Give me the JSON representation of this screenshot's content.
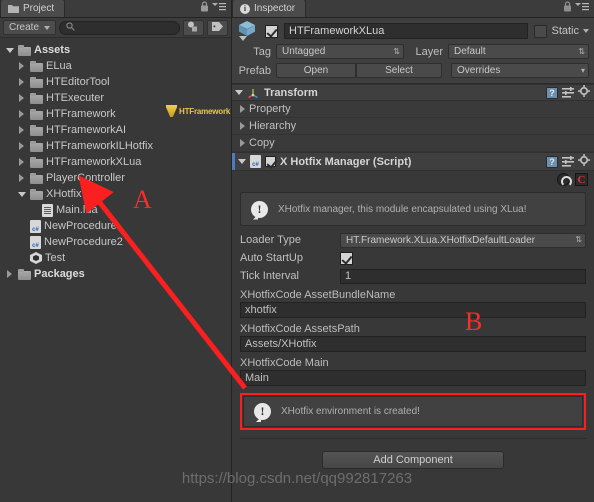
{
  "project": {
    "tab_label": "Project",
    "tab_icon": "folder-icon",
    "lock_icon": "lock-icon",
    "menu_icon": "hamburger-menu-icon",
    "create_label": "Create",
    "search_placeholder": "",
    "search_value": "",
    "search_icon": "search-icon",
    "filter_by_type_icon": "filter-by-type-icon",
    "filter_by_label_icon": "filter-by-label-icon",
    "tree": [
      {
        "label": "Assets",
        "indent": 0,
        "expanded": true,
        "icon": "folder-icon",
        "bold": true
      },
      {
        "label": "ELua",
        "indent": 1,
        "expanded": false,
        "icon": "folder-icon",
        "bold": false
      },
      {
        "label": "HTEditorTool",
        "indent": 1,
        "expanded": false,
        "icon": "folder-icon",
        "bold": false
      },
      {
        "label": "HTExecuter",
        "indent": 1,
        "expanded": false,
        "icon": "folder-icon",
        "bold": false
      },
      {
        "label": "HTFramework",
        "indent": 1,
        "expanded": false,
        "icon": "folder-icon",
        "bold": false
      },
      {
        "label": "HTFrameworkAI",
        "indent": 1,
        "expanded": false,
        "icon": "folder-icon",
        "bold": false
      },
      {
        "label": "HTFrameworkILHotfix",
        "indent": 1,
        "expanded": false,
        "icon": "folder-icon",
        "bold": false
      },
      {
        "label": "HTFrameworkXLua",
        "indent": 1,
        "expanded": false,
        "icon": "folder-icon",
        "bold": false
      },
      {
        "label": "PlayerController",
        "indent": 1,
        "expanded": false,
        "icon": "folder-icon",
        "bold": false
      },
      {
        "label": "XHotfix",
        "indent": 1,
        "expanded": true,
        "icon": "folder-icon",
        "bold": false
      },
      {
        "label": "Main.lua",
        "indent": 2,
        "expanded": null,
        "icon": "text-file-icon",
        "bold": false
      },
      {
        "label": "NewProcedure",
        "indent": 1,
        "expanded": null,
        "icon": "csharp-script-icon",
        "bold": false
      },
      {
        "label": "NewProcedure2",
        "indent": 1,
        "expanded": null,
        "icon": "csharp-script-icon",
        "bold": false
      },
      {
        "label": "Test",
        "indent": 1,
        "expanded": null,
        "icon": "unity-scene-icon",
        "bold": false
      },
      {
        "label": "Packages",
        "indent": 0,
        "expanded": false,
        "icon": "folder-icon",
        "bold": true
      }
    ],
    "htframework_badge": "HTFramework"
  },
  "inspector": {
    "tab_label": "Inspector",
    "tab_icon": "info-icon",
    "lock_icon": "lock-icon",
    "menu_icon": "hamburger-menu-icon",
    "gameobject": {
      "icon": "gameobject-cube-icon",
      "enabled": true,
      "name": "HTFrameworkXLua",
      "static_label": "Static",
      "static_checked": false,
      "tag_label": "Tag",
      "tag_value": "Untagged",
      "layer_label": "Layer",
      "layer_value": "Default",
      "prefab_label": "Prefab",
      "prefab_open": "Open",
      "prefab_select": "Select",
      "prefab_overrides": "Overrides"
    },
    "transform": {
      "title": "Transform",
      "icon": "transform-axis-icon",
      "expanded": true,
      "sub_rows": [
        "Property",
        "Hierarchy",
        "Copy"
      ],
      "help_icon": "help-icon",
      "preset_icon": "preset-icon",
      "gear_icon": "gear-icon"
    },
    "script_component": {
      "title": "X Hotfix Manager (Script)",
      "icon": "csharp-script-icon",
      "enabled": true,
      "expanded": true,
      "help_icon": "help-icon",
      "preset_icon": "preset-icon",
      "gear_icon": "gear-icon",
      "github_icon": "github-icon",
      "csdn_icon": "csdn-c-icon",
      "helpbox_icon": "info-circle-icon",
      "helpbox_text": "XHotfix manager, this module encapsulated using XLua!",
      "fields": [
        {
          "label": "Loader Type",
          "value": "HT.Framework.XLua.XHotfixDefaultLoader",
          "kind": "dropdown"
        },
        {
          "label": "Auto StartUp",
          "value": true,
          "kind": "checkbox"
        },
        {
          "label": "Tick Interval",
          "value": "1",
          "kind": "text"
        }
      ],
      "wide_fields": [
        {
          "label": "XHotfixCode AssetBundleName",
          "value": "xhotfix"
        },
        {
          "label": "XHotfixCode AssetsPath",
          "value": "Assets/XHotfix"
        },
        {
          "label": "XHotfixCode Main",
          "value": "Main"
        }
      ],
      "status_icon": "info-circle-icon",
      "status_text": "XHotfix environment is created!",
      "status_border_color": "#fb2020"
    },
    "add_component_label": "Add Component"
  },
  "annotations": {
    "marker_a": "A",
    "marker_b": "B",
    "arrow_color": "#fb2020",
    "marker_color": "#ff2a2a"
  },
  "watermark": {
    "text": "https://blog.csdn.net/qq992817263"
  }
}
